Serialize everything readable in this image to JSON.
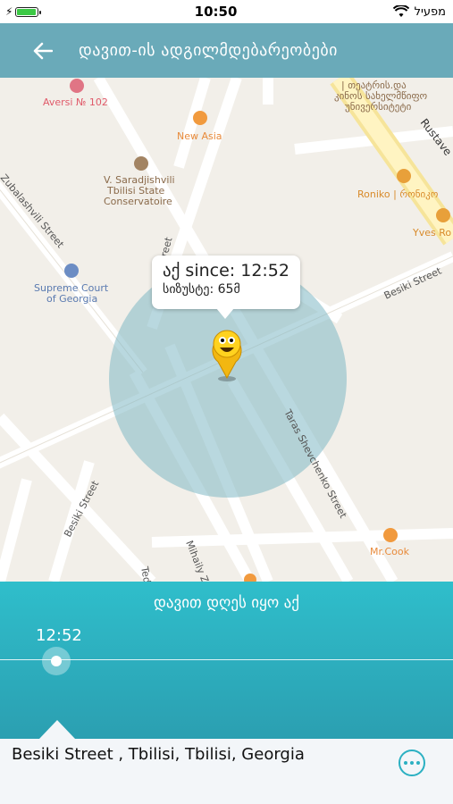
{
  "status_bar": {
    "time": "10:50",
    "carrier": "מפעיל",
    "battery_level": 0.95,
    "battery_color": "#3cc945"
  },
  "header": {
    "title": "დავით-ის ადგილმდებარეობები",
    "back_icon": "arrow-left-icon",
    "background": "#6aaab9"
  },
  "map": {
    "places": [
      {
        "name": "Aversi № 102",
        "color": "#e05a6a",
        "icon": "pharmacy-icon"
      },
      {
        "name": "New Asia",
        "color": "#e88a3a",
        "icon": "restaurant-icon"
      },
      {
        "name": "V. Saradjishvili",
        "color": "#8a6a4a",
        "icon": "school-icon"
      },
      {
        "name": "Tbilisi State",
        "color": "#8a6a4a"
      },
      {
        "name": "Conservatoire",
        "color": "#8a6a4a"
      },
      {
        "name": "Supreme Court",
        "color": "#5a7ab0",
        "icon": "court-icon"
      },
      {
        "name": "of Georgia",
        "color": "#5a7ab0"
      },
      {
        "name": "Roniko | რონიკო",
        "color": "#d88a2a",
        "icon": "shop-icon"
      },
      {
        "name": "Yves Ro",
        "color": "#d88a2a",
        "icon": "shop-icon"
      },
      {
        "name": "Mr.Cook",
        "color": "#e88a3a",
        "icon": "restaurant-icon"
      },
      {
        "name": "| თეატრის.და",
        "color": "#8a6a4a"
      },
      {
        "name": "კინოს სახელმწიფო",
        "color": "#8a6a4a"
      },
      {
        "name": "უნივერსიტეტი",
        "color": "#8a6a4a"
      }
    ],
    "streets": [
      "Zubalashvili Street",
      "Besiki Street",
      "Besiki Street",
      "Taras Shevchenko Street",
      "Rustave",
      "Street",
      "Mihaily Z",
      "Ted"
    ],
    "circle_color": "#7fb8c4",
    "pin_icon": "smiley-pin-icon"
  },
  "callout": {
    "line1": "აქ since: 12:52",
    "line2": "სიზუსტე: 65მ"
  },
  "panel": {
    "title": "დავით დღეს იყო აქ",
    "time": "12:52",
    "slider_position": 0
  },
  "address": {
    "text": "Besiki Street , Tbilisi, Tbilisi, Georgia",
    "more_icon": "more-options-icon"
  }
}
